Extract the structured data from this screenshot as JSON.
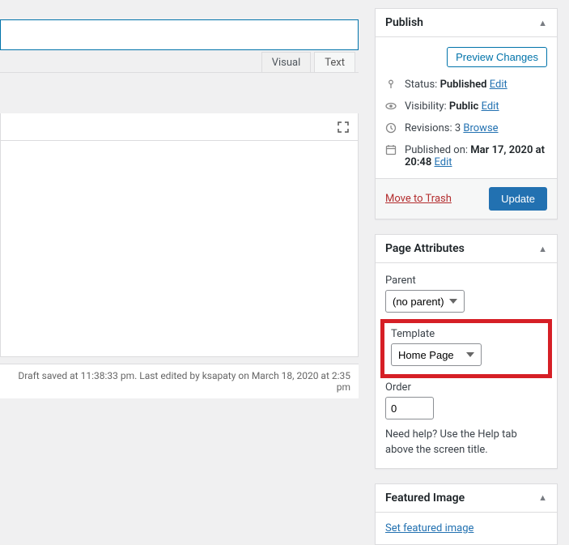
{
  "editor": {
    "tabs": {
      "visual": "Visual",
      "text": "Text"
    },
    "footer": "Draft saved at 11:38:33 pm. Last edited by ksapaty on March 18, 2020 at 2:35 pm"
  },
  "publish": {
    "title": "Publish",
    "preview_btn": "Preview Changes",
    "status_label": "Status:",
    "status_value": "Published",
    "visibility_label": "Visibility:",
    "visibility_value": "Public",
    "revisions_label": "Revisions:",
    "revisions_value": "3",
    "published_label": "Published on:",
    "published_value": "Mar 17, 2020 at 20:48",
    "edit": "Edit",
    "browse": "Browse",
    "trash": "Move to Trash",
    "update": "Update"
  },
  "attributes": {
    "title": "Page Attributes",
    "parent_label": "Parent",
    "parent_value": "(no parent)",
    "template_label": "Template",
    "template_value": "Home Page",
    "order_label": "Order",
    "order_value": "0",
    "help": "Need help? Use the Help tab above the screen title."
  },
  "featured": {
    "title": "Featured Image",
    "set_link": "Set featured image"
  }
}
